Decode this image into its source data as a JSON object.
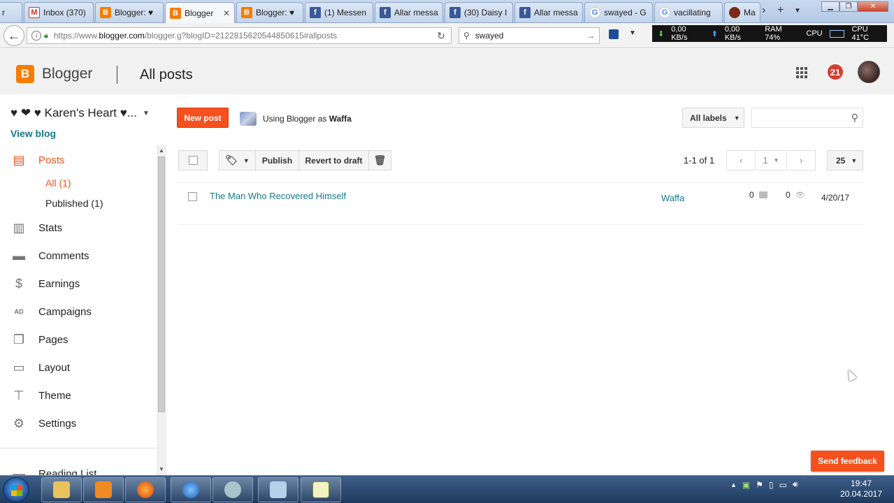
{
  "browser": {
    "tabs": [
      {
        "label": "r",
        "icon": "partial-tab-icon"
      },
      {
        "label": "Inbox (370)",
        "icon": "gmail-icon"
      },
      {
        "label": "Blogger: ♥",
        "icon": "blogger-icon"
      },
      {
        "label": "Blogger",
        "icon": "blogger-icon"
      },
      {
        "label": "Blogger: ♥",
        "icon": "blogger-icon"
      },
      {
        "label": "(1) Messen",
        "icon": "facebook-icon"
      },
      {
        "label": "Allar messa",
        "icon": "facebook-icon"
      },
      {
        "label": "(30) Daisy I",
        "icon": "facebook-icon"
      },
      {
        "label": "Allar messa",
        "icon": "facebook-icon"
      },
      {
        "label": "swayed - G",
        "icon": "google-icon"
      },
      {
        "label": "vacillating",
        "icon": "google-icon"
      },
      {
        "label": "Ma",
        "icon": "avatar-icon"
      }
    ],
    "url_prefix": "https://www.",
    "url_domain": "blogger.com",
    "url_rest": "/blogger.g?blogID=2122815620544850615#allposts",
    "search_value": "swayed",
    "net": {
      "down": "0,00 KB/s",
      "up": "0,00 KB/s",
      "ram": "RAM 74%",
      "cpu": "CPU",
      "cpu_temp": "CPU 41°C"
    }
  },
  "header": {
    "brand": "Blogger",
    "page_title": "All posts",
    "notification_count": "21"
  },
  "sidebar": {
    "blog_name": "♥ ❤ ♥ Karen's Heart ♥...",
    "view_blog": "View blog",
    "posts_label": "Posts",
    "sub_all": "All (1)",
    "sub_published": "Published (1)",
    "items": [
      {
        "label": "Stats",
        "icon": "stats-icon"
      },
      {
        "label": "Comments",
        "icon": "comments-icon"
      },
      {
        "label": "Earnings",
        "icon": "dollar-icon"
      },
      {
        "label": "Campaigns",
        "icon": "ad-icon"
      },
      {
        "label": "Pages",
        "icon": "pages-icon"
      },
      {
        "label": "Layout",
        "icon": "layout-icon"
      },
      {
        "label": "Theme",
        "icon": "theme-icon"
      },
      {
        "label": "Settings",
        "icon": "gear-icon"
      }
    ],
    "reading_list": "Reading List"
  },
  "main": {
    "new_post": "New post",
    "using_as_prefix": "Using Blogger as",
    "using_as_user": "Waffa",
    "all_labels": "All labels",
    "toolbar": {
      "publish": "Publish",
      "revert": "Revert to draft"
    },
    "pager": {
      "range": "1-1 of 1",
      "page": "1",
      "per_page": "25"
    },
    "posts": [
      {
        "title": "The Man Who Recovered Himself",
        "author": "Waffa",
        "comments": "0",
        "views": "0",
        "date": "4/20/17"
      }
    ],
    "send_feedback": "Send feedback"
  },
  "taskbar": {
    "time": "19:47",
    "date": "20.04.2017"
  },
  "colors": {
    "accent": "#f4511e",
    "link": "#16798a",
    "brand": "#f57d00"
  }
}
